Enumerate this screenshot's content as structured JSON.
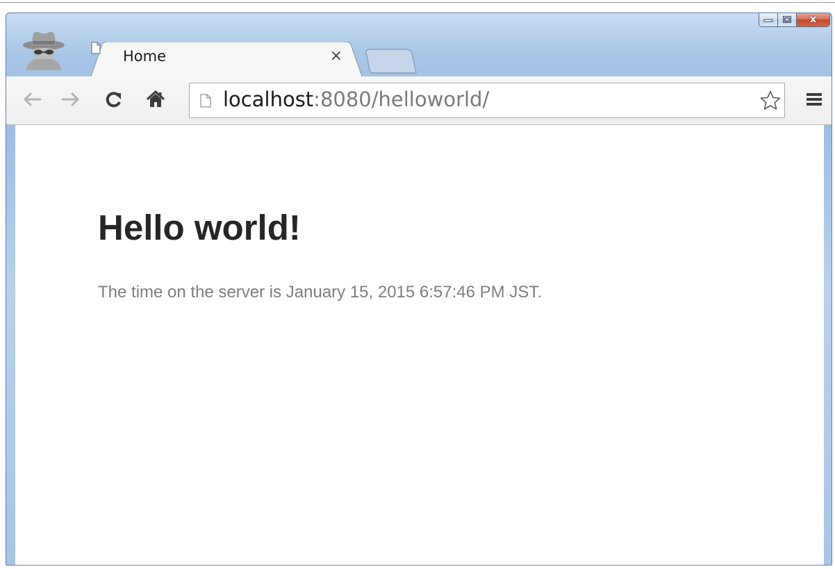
{
  "window": {
    "close_glyph": "x",
    "icons": {
      "minimize": "minimize-icon",
      "maximize": "maximize-icon",
      "close": "close-icon",
      "incognito": "incognito-icon"
    }
  },
  "tabs": [
    {
      "title": "Home",
      "close_glyph": "×",
      "icon": "document-icon",
      "active": true
    }
  ],
  "toolbar": {
    "back_icon": "back-arrow-icon",
    "forward_icon": "forward-arrow-icon",
    "reload_icon": "reload-icon",
    "home_icon": "home-icon",
    "url_host": "localhost",
    "url_rest": ":8080/helloworld/",
    "bookmark_icon": "star-icon",
    "menu_icon": "hamburger-menu-icon"
  },
  "page": {
    "heading": "Hello world!",
    "server_time": "The time on the server is January 15, 2015 6:57:46 PM JST."
  },
  "colors": {
    "frame": "#a8c5e6",
    "toolbar": "#f2f2f2",
    "heading": "#262626",
    "body_text": "#7e7e7e",
    "close_button": "#c94a32"
  }
}
